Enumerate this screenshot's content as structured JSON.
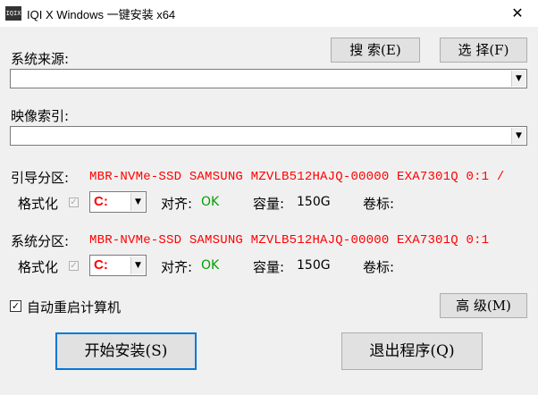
{
  "window": {
    "icon_text": "IQIX",
    "title": "IQI X Windows 一键安装 x64",
    "close": "✕"
  },
  "source": {
    "label": "系统来源:",
    "value": "",
    "search_button": "搜 索(E)",
    "select_button": "选 择(F)"
  },
  "index": {
    "label": "映像索引:",
    "value": ""
  },
  "boot_partition": {
    "label": "引导分区:",
    "disk": "MBR-NVMe-SSD SAMSUNG MZVLB512HAJQ-00000 EXA7301Q 0:1 /",
    "format_label": "格式化",
    "format_checked": false,
    "drive": "C:",
    "align_label": "对齐:",
    "align_value": "OK",
    "capacity_label": "容量:",
    "capacity_value": "150G",
    "volume_label": "卷标:",
    "volume_value": ""
  },
  "system_partition": {
    "label": "系统分区:",
    "disk": "MBR-NVMe-SSD SAMSUNG MZVLB512HAJQ-00000 EXA7301Q 0:1",
    "format_label": "格式化",
    "format_checked": false,
    "drive": "C:",
    "align_label": "对齐:",
    "align_value": "OK",
    "capacity_label": "容量:",
    "capacity_value": "150G",
    "volume_label": "卷标:",
    "volume_value": ""
  },
  "auto_restart": {
    "label": "自动重启计算机",
    "checked": true
  },
  "advanced_button": "高 级(M)",
  "start_button": "开始安装(S)",
  "exit_button": "退出程序(Q)",
  "colors": {
    "disk_text": "#ff0000",
    "ok_text": "#00a000",
    "accent": "#0078d7"
  }
}
